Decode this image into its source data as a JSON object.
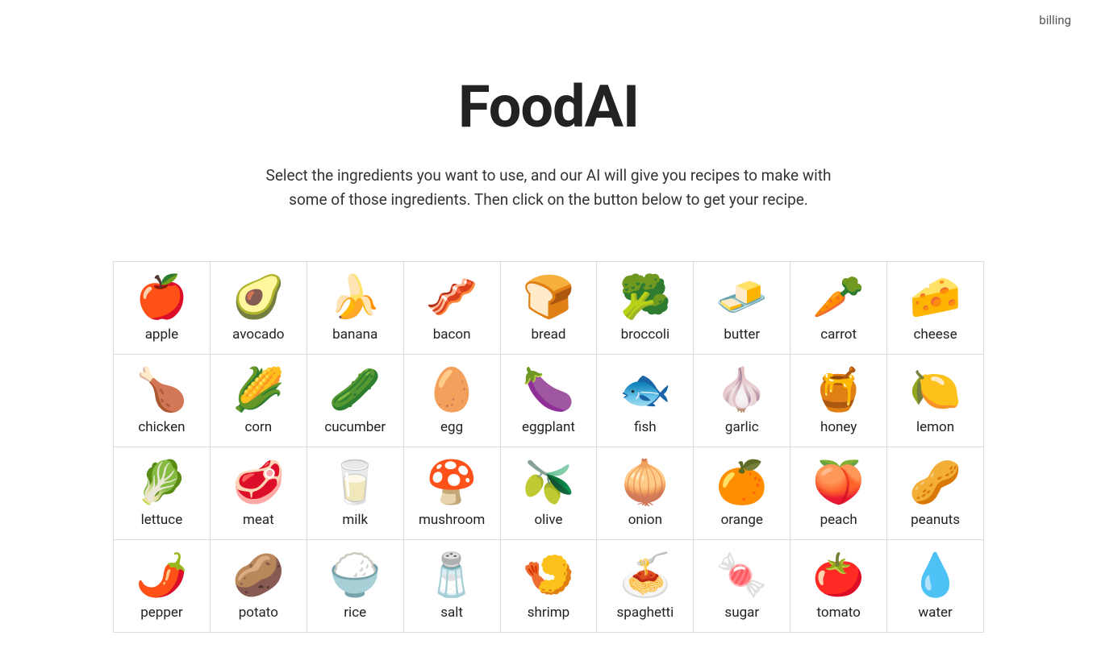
{
  "header": {
    "billing_label": "billing"
  },
  "hero": {
    "title": "FoodAI",
    "description_line1": "Select the ingredients you want to use, and our AI will give you recipes to make with",
    "description_line2": "some of those ingredients. Then click on the button below to get your recipe."
  },
  "ingredients": [
    {
      "id": "apple",
      "label": "apple",
      "emoji": "🍎"
    },
    {
      "id": "avocado",
      "label": "avocado",
      "emoji": "🥑"
    },
    {
      "id": "banana",
      "label": "banana",
      "emoji": "🍌"
    },
    {
      "id": "bacon",
      "label": "bacon",
      "emoji": "🥓"
    },
    {
      "id": "bread",
      "label": "bread",
      "emoji": "🍞"
    },
    {
      "id": "broccoli",
      "label": "broccoli",
      "emoji": "🥦"
    },
    {
      "id": "butter",
      "label": "butter",
      "emoji": "🧈"
    },
    {
      "id": "carrot",
      "label": "carrot",
      "emoji": "🥕"
    },
    {
      "id": "cheese",
      "label": "cheese",
      "emoji": "🧀"
    },
    {
      "id": "chicken",
      "label": "chicken",
      "emoji": "🍗"
    },
    {
      "id": "corn",
      "label": "corn",
      "emoji": "🌽"
    },
    {
      "id": "cucumber",
      "label": "cucumber",
      "emoji": "🥒"
    },
    {
      "id": "egg",
      "label": "egg",
      "emoji": "🥚"
    },
    {
      "id": "eggplant",
      "label": "eggplant",
      "emoji": "🍆"
    },
    {
      "id": "fish",
      "label": "fish",
      "emoji": "🐟"
    },
    {
      "id": "garlic",
      "label": "garlic",
      "emoji": "🧄"
    },
    {
      "id": "honey",
      "label": "honey",
      "emoji": "🍯"
    },
    {
      "id": "lemon",
      "label": "lemon",
      "emoji": "🍋"
    },
    {
      "id": "lettuce",
      "label": "lettuce",
      "emoji": "🥬"
    },
    {
      "id": "meat",
      "label": "meat",
      "emoji": "🥩"
    },
    {
      "id": "milk",
      "label": "milk",
      "emoji": "🥛"
    },
    {
      "id": "mushroom",
      "label": "mushroom",
      "emoji": "🍄"
    },
    {
      "id": "olive",
      "label": "olive",
      "emoji": "🫒"
    },
    {
      "id": "onion",
      "label": "onion",
      "emoji": "🧅"
    },
    {
      "id": "orange",
      "label": "orange",
      "emoji": "🍊"
    },
    {
      "id": "peach",
      "label": "peach",
      "emoji": "🍑"
    },
    {
      "id": "peanuts",
      "label": "peanuts",
      "emoji": "🥜"
    },
    {
      "id": "pepper",
      "label": "pepper",
      "emoji": "🌶️"
    },
    {
      "id": "potato",
      "label": "potato",
      "emoji": "🥔"
    },
    {
      "id": "rice",
      "label": "rice",
      "emoji": "🍚"
    },
    {
      "id": "salt",
      "label": "salt",
      "emoji": "🧂"
    },
    {
      "id": "shrimp",
      "label": "shrimp",
      "emoji": "🍤"
    },
    {
      "id": "spaghetti",
      "label": "spaghetti",
      "emoji": "🍝"
    },
    {
      "id": "sugar",
      "label": "sugar",
      "emoji": "🍬"
    },
    {
      "id": "tomato",
      "label": "tomato",
      "emoji": "🍅"
    },
    {
      "id": "water",
      "label": "water",
      "emoji": "💧"
    }
  ]
}
